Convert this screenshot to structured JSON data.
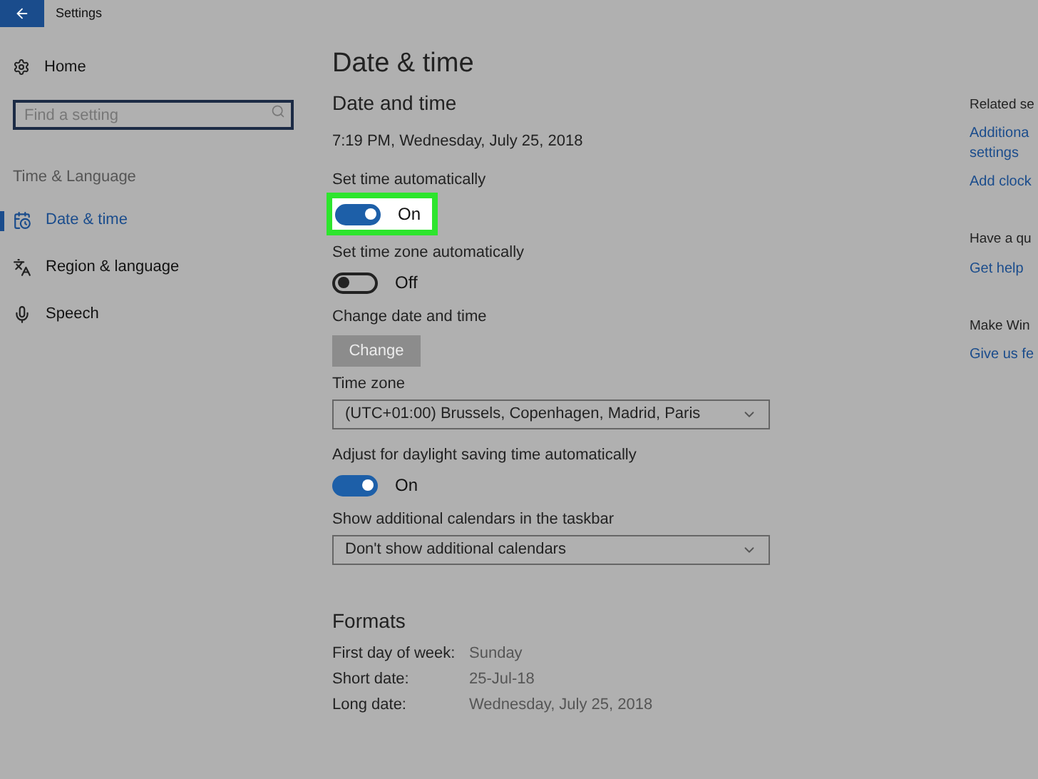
{
  "window": {
    "title": "Settings"
  },
  "sidebar": {
    "home": "Home",
    "search": {
      "placeholder": "Find a setting"
    },
    "section": "Time & Language",
    "items": [
      {
        "label": "Date & time",
        "selected": true
      },
      {
        "label": "Region & language",
        "selected": false
      },
      {
        "label": "Speech",
        "selected": false
      }
    ]
  },
  "main": {
    "title": "Date & time",
    "subtitle": "Date and time",
    "current": "7:19 PM, Wednesday, July 25, 2018",
    "settings": [
      {
        "kind": "toggle",
        "label": "Set time automatically",
        "on": true,
        "state": "On",
        "highlighted": true
      },
      {
        "kind": "toggle",
        "label": "Set time zone automatically",
        "on": false,
        "state": "Off",
        "highlighted": false
      },
      {
        "kind": "button",
        "label": "Change date and time",
        "button": "Change",
        "disabled": true
      },
      {
        "kind": "dropdown",
        "label": "Time zone",
        "value": "(UTC+01:00) Brussels, Copenhagen, Madrid, Paris"
      },
      {
        "kind": "toggle",
        "label": "Adjust for daylight saving time automatically",
        "on": true,
        "state": "On",
        "highlighted": false
      },
      {
        "kind": "dropdown",
        "label": "Show additional calendars in the taskbar",
        "value": "Don't show additional calendars"
      }
    ],
    "formats": {
      "title": "Formats",
      "rows": [
        {
          "label": "First day of week:",
          "value": "Sunday"
        },
        {
          "label": "Short date:",
          "value": "25-Jul-18"
        },
        {
          "label": "Long date:",
          "value": "Wednesday, July 25, 2018"
        }
      ]
    }
  },
  "related": [
    {
      "heading": "Related se",
      "links": [
        "Additiona\nsettings",
        "Add clock"
      ]
    },
    {
      "heading": "Have a qu",
      "links": [
        "Get help"
      ]
    },
    {
      "heading": "Make Win",
      "links": [
        "Give us fe"
      ]
    }
  ]
}
